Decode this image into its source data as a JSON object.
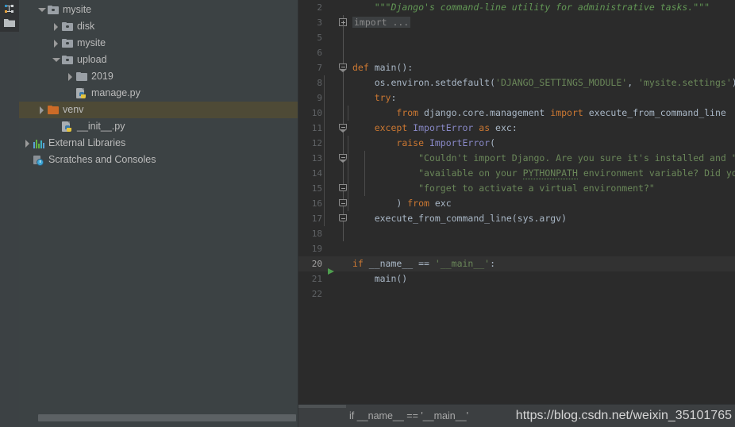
{
  "toolstrip": {
    "icons": [
      {
        "name": "structure-icon",
        "label": "Structure"
      },
      {
        "name": "project-folder-icon",
        "label": "Project"
      }
    ]
  },
  "project_panel": {
    "tree": [
      {
        "depth": 0,
        "arrow": "expanded",
        "icon": "module-folder-icon",
        "label": "mysite",
        "selected": false
      },
      {
        "depth": 1,
        "arrow": "collapsed",
        "icon": "module-folder-icon",
        "label": "disk",
        "selected": false
      },
      {
        "depth": 1,
        "arrow": "collapsed",
        "icon": "module-folder-icon",
        "label": "mysite",
        "selected": false
      },
      {
        "depth": 1,
        "arrow": "expanded",
        "icon": "module-folder-icon",
        "label": "upload",
        "selected": false
      },
      {
        "depth": 2,
        "arrow": "collapsed",
        "icon": "folder-icon",
        "label": "2019",
        "selected": false
      },
      {
        "depth": 2,
        "arrow": "none",
        "icon": "python-file-icon",
        "label": "manage.py",
        "selected": false
      },
      {
        "depth": 0,
        "arrow": "collapsed",
        "icon": "venv-folder-icon",
        "label": "venv",
        "selected": true
      },
      {
        "depth": 1,
        "arrow": "none",
        "icon": "python-file-icon",
        "label": "__init__.py",
        "selected": false
      },
      {
        "depth": -1,
        "arrow": "collapsed",
        "icon": "external-libraries-icon",
        "label": "External Libraries",
        "selected": false
      },
      {
        "depth": -1,
        "arrow": "none",
        "icon": "scratches-icon",
        "label": "Scratches and Consoles",
        "selected": false
      }
    ],
    "hscrollbar": {
      "name": "project-horizontal-scrollbar"
    }
  },
  "editor": {
    "lines": [
      {
        "number": "2",
        "run": false,
        "hl": false,
        "fold": "none",
        "guides": [],
        "tokens": [
          {
            "t": "t-plain",
            "v": "    "
          },
          {
            "t": "t-doc",
            "v": "\"\"\"Django's command-line utility for administrative tasks.\"\"\""
          }
        ]
      },
      {
        "number": "3",
        "run": false,
        "hl": false,
        "fold": "plus",
        "guides": [],
        "tokens": [
          {
            "t": "fold-placeholder",
            "v": "import ..."
          }
        ]
      },
      {
        "number": "5",
        "run": false,
        "hl": false,
        "fold": "line",
        "guides": [],
        "tokens": []
      },
      {
        "number": "6",
        "run": false,
        "hl": false,
        "fold": "line",
        "guides": [],
        "tokens": []
      },
      {
        "number": "7",
        "run": false,
        "hl": false,
        "fold": "arrowdown",
        "guides": [],
        "tokens": [
          {
            "t": "t-kw",
            "v": "def "
          },
          {
            "t": "t-plain",
            "v": "main():"
          }
        ]
      },
      {
        "number": "8",
        "run": false,
        "hl": false,
        "fold": "line",
        "guides": [
          32
        ],
        "tokens": [
          {
            "t": "t-plain",
            "v": "    os.environ.setdefault("
          },
          {
            "t": "t-str",
            "v": "'DJANGO_SETTINGS_MODULE'"
          },
          {
            "t": "t-plain",
            "v": ", "
          },
          {
            "t": "t-str",
            "v": "'mysite.settings'"
          },
          {
            "t": "t-plain",
            "v": ")"
          }
        ]
      },
      {
        "number": "9",
        "run": false,
        "hl": false,
        "fold": "line",
        "guides": [
          32
        ],
        "tokens": [
          {
            "t": "t-plain",
            "v": "    "
          },
          {
            "t": "t-kw",
            "v": "try"
          },
          {
            "t": "t-plain",
            "v": ":"
          }
        ]
      },
      {
        "number": "10",
        "run": false,
        "hl": false,
        "fold": "line",
        "guides": [
          32,
          62
        ],
        "tokens": [
          {
            "t": "t-plain",
            "v": "        "
          },
          {
            "t": "t-kw",
            "v": "from "
          },
          {
            "t": "t-plain",
            "v": "django.core.management "
          },
          {
            "t": "t-kw",
            "v": "import "
          },
          {
            "t": "t-plain",
            "v": "execute_from_command_line"
          }
        ]
      },
      {
        "number": "11",
        "run": false,
        "hl": false,
        "fold": "arrowdown",
        "guides": [
          32
        ],
        "tokens": [
          {
            "t": "t-plain",
            "v": "    "
          },
          {
            "t": "t-kw",
            "v": "except "
          },
          {
            "t": "t-cls",
            "v": "ImportError "
          },
          {
            "t": "t-kw",
            "v": "as "
          },
          {
            "t": "t-plain",
            "v": "exc:"
          }
        ]
      },
      {
        "number": "12",
        "run": false,
        "hl": false,
        "fold": "line",
        "guides": [
          32,
          62
        ],
        "tokens": [
          {
            "t": "t-plain",
            "v": "        "
          },
          {
            "t": "t-kw",
            "v": "raise "
          },
          {
            "t": "t-cls",
            "v": "ImportError"
          },
          {
            "t": "t-plain",
            "v": "("
          }
        ]
      },
      {
        "number": "13",
        "run": false,
        "hl": false,
        "fold": "arrowdown",
        "guides": [
          32,
          62,
          83
        ],
        "tokens": [
          {
            "t": "t-plain",
            "v": "            "
          },
          {
            "t": "t-str",
            "v": "\"Couldn't import Django. Are you sure it's installed and \""
          }
        ]
      },
      {
        "number": "14",
        "run": false,
        "hl": false,
        "fold": "line",
        "guides": [
          32,
          62,
          83
        ],
        "tokens": [
          {
            "t": "t-plain",
            "v": "            "
          },
          {
            "t": "t-str",
            "v": "\"available on your "
          },
          {
            "t": "t-str squiggle",
            "v": "PYTHONPATH"
          },
          {
            "t": "t-str",
            "v": " environment variable? Did you \""
          }
        ]
      },
      {
        "number": "15",
        "run": false,
        "hl": false,
        "fold": "endcap",
        "guides": [
          32,
          62,
          83
        ],
        "tokens": [
          {
            "t": "t-plain",
            "v": "            "
          },
          {
            "t": "t-str",
            "v": "\"forget to activate a virtual environment?\""
          }
        ]
      },
      {
        "number": "16",
        "run": false,
        "hl": false,
        "fold": "endcap",
        "guides": [
          32,
          62
        ],
        "tokens": [
          {
            "t": "t-plain",
            "v": "        ) "
          },
          {
            "t": "t-kw",
            "v": "from "
          },
          {
            "t": "t-plain",
            "v": "exc"
          }
        ]
      },
      {
        "number": "17",
        "run": false,
        "hl": false,
        "fold": "endcap",
        "guides": [
          32
        ],
        "tokens": [
          {
            "t": "t-plain",
            "v": "    execute_from_command_line(sys.argv)"
          }
        ]
      },
      {
        "number": "18",
        "run": false,
        "hl": false,
        "fold": "line",
        "guides": [],
        "tokens": []
      },
      {
        "number": "19",
        "run": false,
        "hl": false,
        "fold": "none",
        "guides": [],
        "tokens": []
      },
      {
        "number": "20",
        "run": true,
        "hl": true,
        "fold": "none",
        "guides": [],
        "tokens": [
          {
            "t": "t-kw",
            "v": "if "
          },
          {
            "t": "t-plain",
            "v": "__name__ == "
          },
          {
            "t": "t-str",
            "v": "'__main__'"
          },
          {
            "t": "t-plain",
            "v": ":"
          }
        ]
      },
      {
        "number": "21",
        "run": false,
        "hl": false,
        "fold": "none",
        "guides": [],
        "tokens": [
          {
            "t": "t-plain",
            "v": "    main()"
          }
        ]
      },
      {
        "number": "22",
        "run": false,
        "hl": false,
        "fold": "none",
        "guides": [],
        "tokens": []
      }
    ]
  },
  "bottom_bar": {
    "breadcrumb": "if __name__ == '__main__'",
    "watermark": "https://blog.csdn.net/weixin_35101765"
  },
  "colors": {
    "editor_bg": "#2b2b2b",
    "panel_bg": "#3c4244",
    "chrome_bg": "#3c3f41",
    "selection": "#4e4a36",
    "keyword": "#cc7832",
    "string": "#6a8759",
    "docstring": "#629755",
    "class": "#8888c6",
    "default_text": "#a9b7c6",
    "line_number": "#606366",
    "run_marker": "#4f9e4f",
    "venv_folder": "#cc6b27"
  }
}
